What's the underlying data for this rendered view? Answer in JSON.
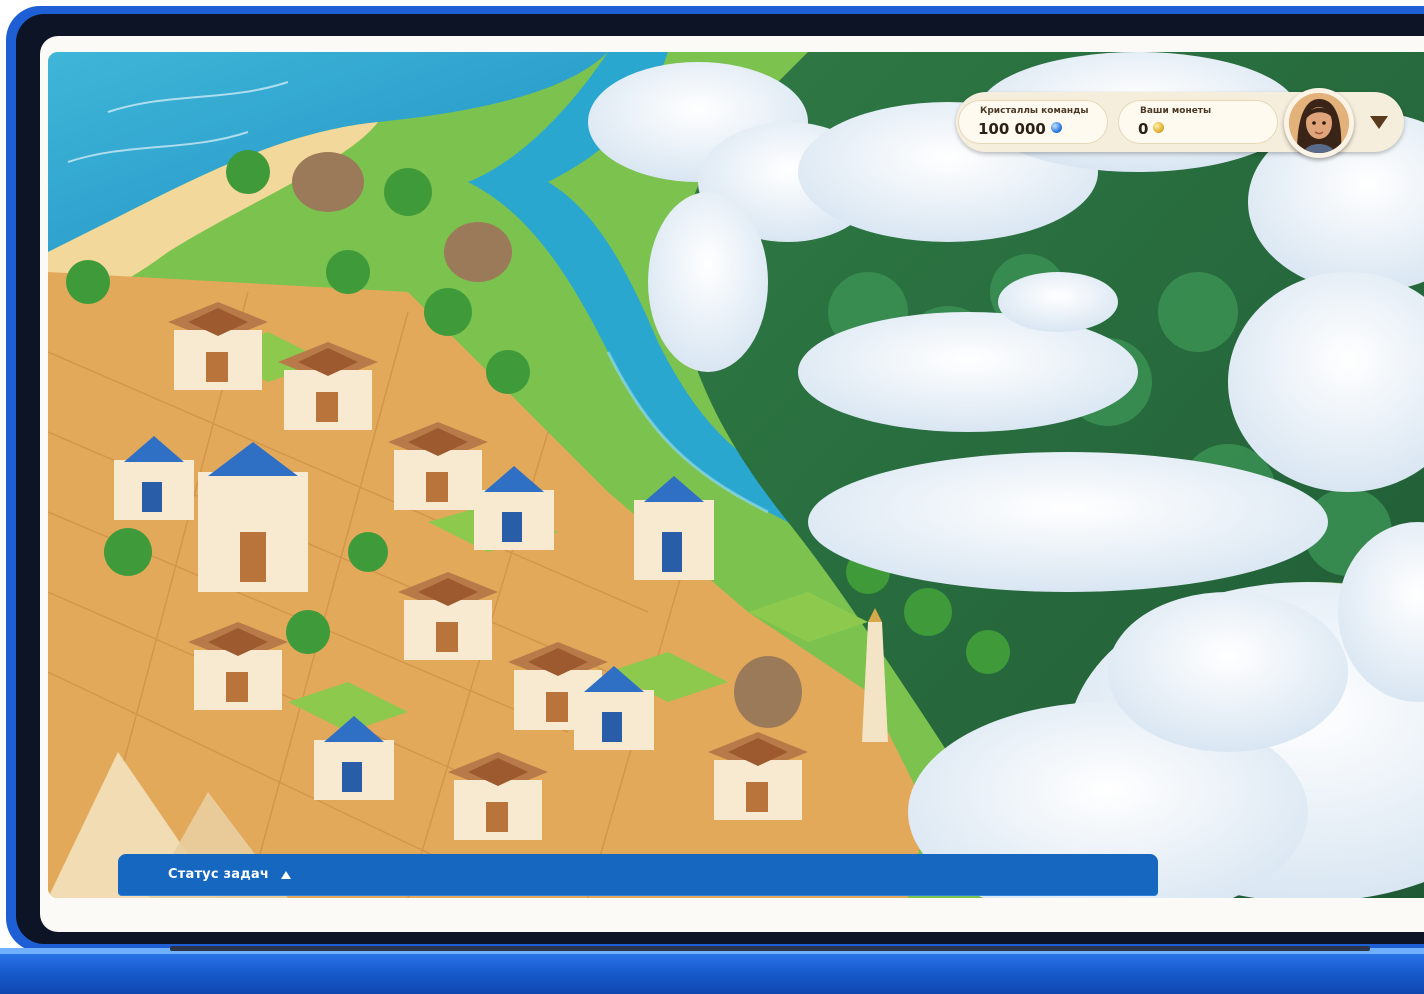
{
  "hud": {
    "team_crystals_label": "Кристаллы команды",
    "team_crystals_value": "100 000",
    "team_crystals_icon": "crystal-icon",
    "your_coins_label": "Ваши монеты",
    "your_coins_value": "0",
    "your_coins_icon": "coin-icon",
    "avatar_icon": "avatar",
    "dropdown_icon": "chevron-down-icon"
  },
  "task_bar": {
    "label": "Статус задач",
    "toggle_icon": "chevron-up-icon"
  },
  "colors": {
    "task_bar": "#1567bf",
    "hud_background": "#f6eedc",
    "laptop_frame": "#1f5fd6"
  }
}
